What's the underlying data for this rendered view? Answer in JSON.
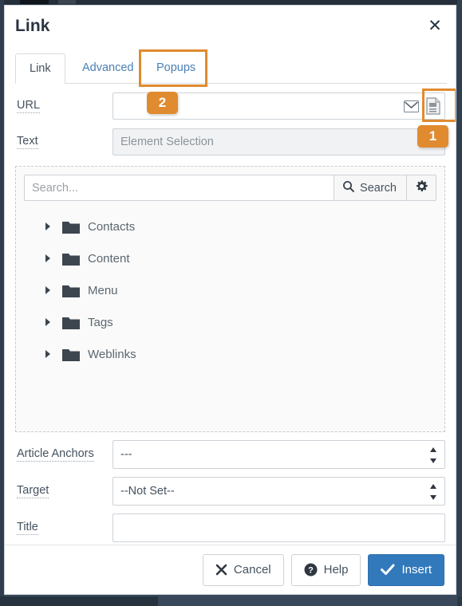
{
  "dialog": {
    "title": "Link",
    "close_icon": "close-icon"
  },
  "tabs": [
    {
      "label": "Link",
      "active": true
    },
    {
      "label": "Advanced",
      "active": false
    },
    {
      "label": "Popups",
      "active": false,
      "highlighted": true
    }
  ],
  "fields": {
    "url": {
      "label": "URL",
      "value": "",
      "placeholder": "",
      "icons": [
        "email-icon",
        "article-document-icon"
      ]
    },
    "text": {
      "label": "Text",
      "value": "",
      "placeholder": "Element Selection",
      "disabled": true
    },
    "article_anchors": {
      "label": "Article Anchors",
      "value": "---"
    },
    "target": {
      "label": "Target",
      "value": "--Not Set--"
    },
    "title": {
      "label": "Title",
      "value": "",
      "placeholder": ""
    }
  },
  "search": {
    "placeholder": "Search...",
    "value": "",
    "button_label": "Search",
    "search_icon": "search-icon",
    "options_icon": "gear-icon"
  },
  "tree": {
    "items": [
      {
        "label": "Contacts",
        "expanded": false
      },
      {
        "label": "Content",
        "expanded": false
      },
      {
        "label": "Menu",
        "expanded": false
      },
      {
        "label": "Tags",
        "expanded": false
      },
      {
        "label": "Weblinks",
        "expanded": false
      }
    ]
  },
  "footer": {
    "cancel_label": "Cancel",
    "help_label": "Help",
    "insert_label": "Insert"
  },
  "annotations": [
    {
      "id": "badge-1",
      "label": "1",
      "target": "article-document-icon-button"
    },
    {
      "id": "badge-2",
      "label": "2",
      "target": "url-input"
    }
  ],
  "colors": {
    "accent_orange": "#e08b30",
    "primary_blue": "#3279bc",
    "link_blue": "#4a7fb5",
    "text": "#45525f"
  }
}
